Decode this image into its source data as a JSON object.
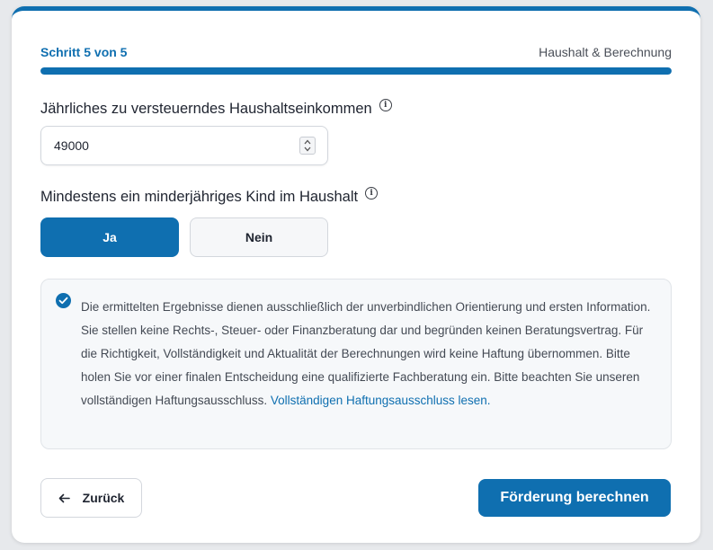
{
  "progress": {
    "step_label": "Schritt 5 von 5",
    "step_title": "Haushalt & Berechnung",
    "fraction": 1.0
  },
  "income": {
    "label": "Jährliches zu versteuerndes Haushaltseinkommen",
    "value": "49000",
    "info_icon": "info-icon"
  },
  "child": {
    "label": "Mindestens ein minderjähriges Kind im Haushalt",
    "info_icon": "info-icon",
    "options": [
      "Ja",
      "Nein"
    ],
    "selected": "Ja"
  },
  "disclaimer": {
    "checked": true,
    "text": "Die ermittelten Ergebnisse dienen ausschließlich der unverbindlichen Orientierung und ersten Information. Sie stellen keine Rechts-, Steuer- oder Finanzberatung dar und begründen keinen Beratungsvertrag. Für die Richtigkeit, Vollständigkeit und Aktualität der Berechnungen wird keine Haftung übernommen. Bitte holen Sie vor einer finalen Entscheidung eine qualifizierte Fachberatung ein. Bitte beachten Sie unseren vollständigen Haftungsausschluss.",
    "link_text": "Vollständigen Haftungsausschluss lesen."
  },
  "actions": {
    "back_label": "Zurück",
    "submit_label": "Förderung berechnen"
  },
  "colors": {
    "accent": "#0f6fb0",
    "text": "#1f2430",
    "muted": "#444a54",
    "panel_bg": "#f6f8fa"
  }
}
